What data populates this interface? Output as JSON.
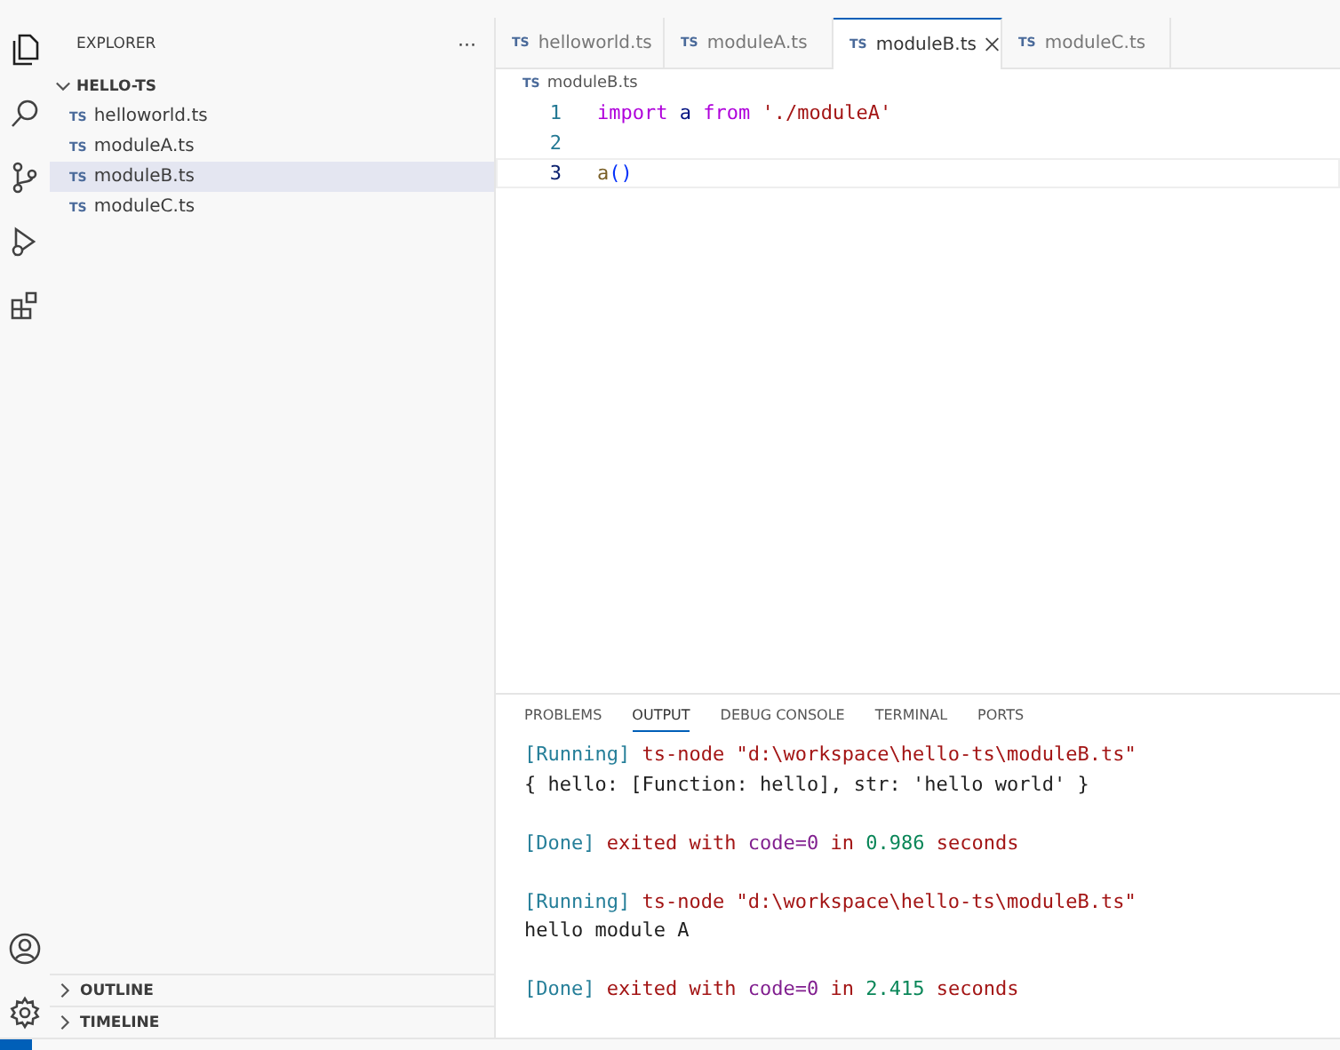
{
  "activity_bar": {
    "top": [
      {
        "kind": "files",
        "selected": true
      },
      {
        "kind": "search",
        "selected": false
      },
      {
        "kind": "source-control",
        "selected": false
      },
      {
        "kind": "run",
        "selected": false
      },
      {
        "kind": "extensions",
        "selected": false
      }
    ],
    "bottom": [
      {
        "kind": "account"
      },
      {
        "kind": "settings"
      }
    ]
  },
  "sidebar": {
    "title": "EXPLORER",
    "more": "···",
    "folder": {
      "name": "HELLO-TS",
      "expanded": true,
      "files": [
        {
          "badge": "TS",
          "name": "helloworld.ts",
          "selected": false
        },
        {
          "badge": "TS",
          "name": "moduleA.ts",
          "selected": false
        },
        {
          "badge": "TS",
          "name": "moduleB.ts",
          "selected": true
        },
        {
          "badge": "TS",
          "name": "moduleC.ts",
          "selected": false
        }
      ]
    },
    "sections": [
      {
        "name": "OUTLINE",
        "expanded": false
      },
      {
        "name": "TIMELINE",
        "expanded": false
      }
    ]
  },
  "tabs": [
    {
      "badge": "TS",
      "label": "helloworld.ts",
      "selected": false
    },
    {
      "badge": "TS",
      "label": "moduleA.ts",
      "selected": false
    },
    {
      "badge": "TS",
      "label": "moduleB.ts",
      "selected": true
    },
    {
      "badge": "TS",
      "label": "moduleC.ts",
      "selected": false
    }
  ],
  "breadcrumb": {
    "badge": "TS",
    "label": "moduleB.ts"
  },
  "code": [
    {
      "number": "1",
      "current": false,
      "tokens": [
        {
          "kind": "keyword",
          "text": "import"
        },
        {
          "kind": "variable",
          "text": "a",
          "space_before": true
        },
        {
          "kind": "keyword",
          "text": "from",
          "space_before": true
        },
        {
          "kind": "string",
          "text": "'./moduleA'",
          "space_before": true
        }
      ]
    },
    {
      "number": "2",
      "current": false
    },
    {
      "number": "3",
      "current": true,
      "tokens": [
        {
          "kind": "function",
          "text": "a"
        },
        {
          "kind": "punct",
          "text": "()"
        }
      ]
    }
  ],
  "panel": {
    "tabs": [
      {
        "label": "PROBLEMS",
        "selected": false
      },
      {
        "label": "OUTPUT",
        "selected": true
      },
      {
        "label": "DEBUG CONSOLE",
        "selected": false
      },
      {
        "label": "TERMINAL",
        "selected": false
      },
      {
        "label": "PORTS",
        "selected": false
      }
    ],
    "output": [
      {
        "segments": [
          {
            "kind": "tag",
            "text": "[Running]"
          },
          {
            "kind": "msg",
            "text": " ts-node \"d:\\workspace\\hello-ts\\moduleB.ts\""
          }
        ]
      },
      {
        "segments": [
          {
            "kind": "plain",
            "text": "{ hello: [Function: hello], str: 'hello world' }"
          }
        ]
      },
      {
        "blank_before": true,
        "segments": [
          {
            "kind": "tag",
            "text": "[Done]"
          },
          {
            "kind": "msg",
            "text": " exited with "
          },
          {
            "kind": "code",
            "text": "code=0"
          },
          {
            "kind": "msg",
            "text": " in "
          },
          {
            "kind": "number",
            "text": "0.986"
          },
          {
            "kind": "msg",
            "text": " seconds"
          }
        ]
      },
      {
        "blank_before": true,
        "segments": [
          {
            "kind": "tag",
            "text": "[Running]"
          },
          {
            "kind": "msg",
            "text": " ts-node \"d:\\workspace\\hello-ts\\moduleB.ts\""
          }
        ]
      },
      {
        "segments": [
          {
            "kind": "plain",
            "text": "hello module A"
          }
        ]
      },
      {
        "blank_before": true,
        "segments": [
          {
            "kind": "tag",
            "text": "[Done]"
          },
          {
            "kind": "msg",
            "text": " exited with "
          },
          {
            "kind": "code",
            "text": "code=0"
          },
          {
            "kind": "msg",
            "text": " in "
          },
          {
            "kind": "number",
            "text": "2.415"
          },
          {
            "kind": "msg",
            "text": " seconds"
          }
        ]
      }
    ]
  }
}
